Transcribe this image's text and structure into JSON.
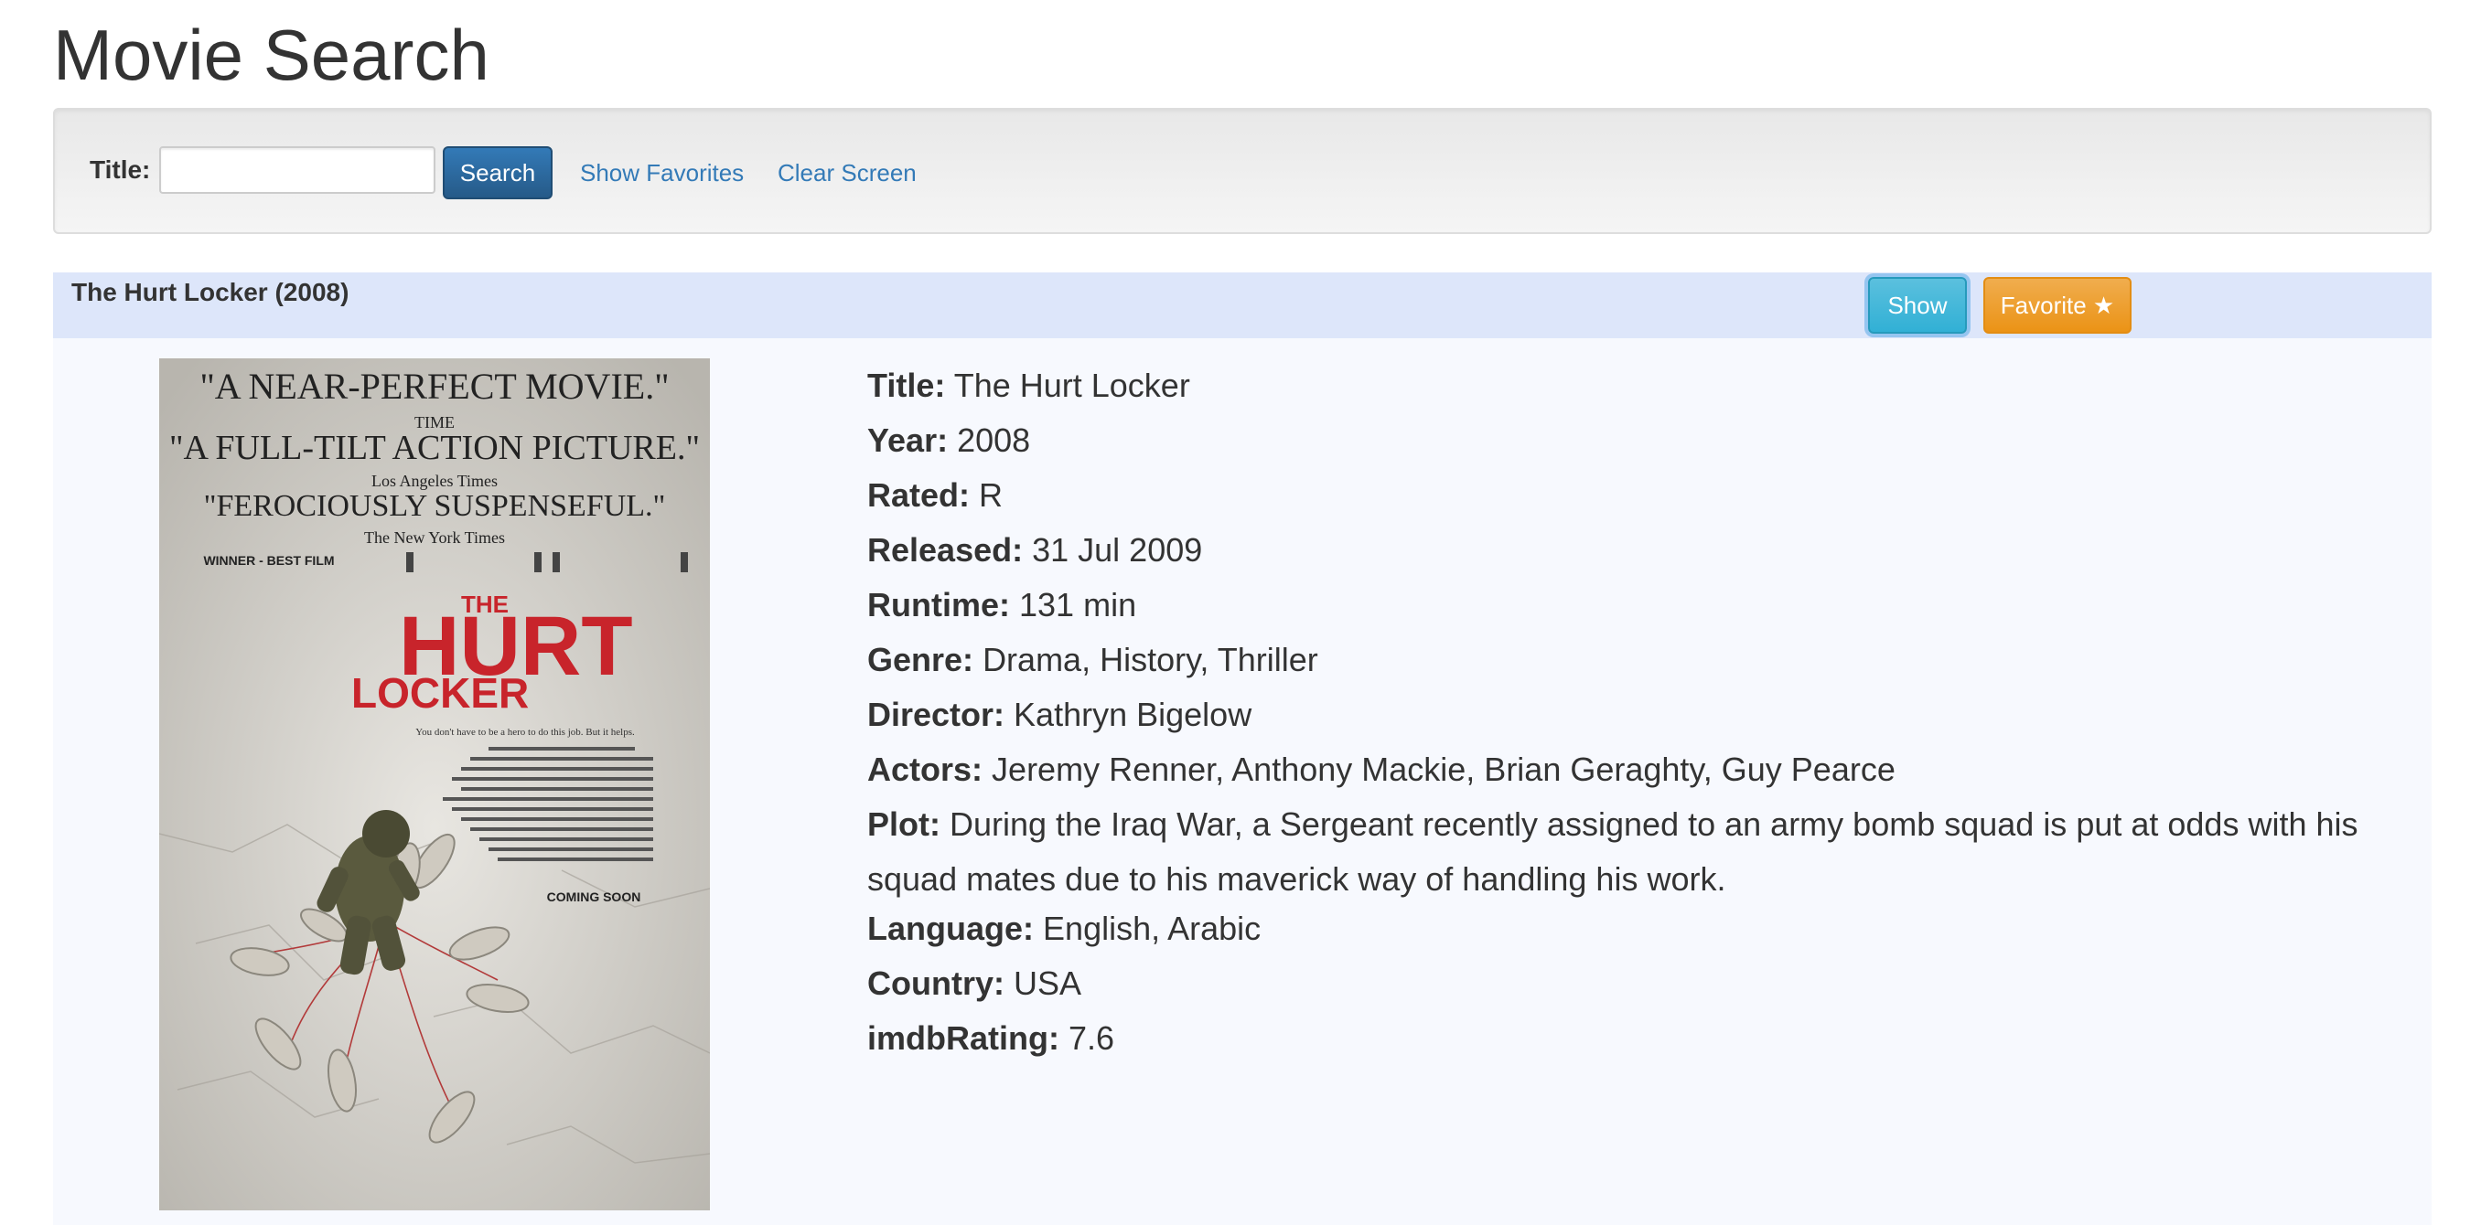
{
  "page": {
    "title": "Movie Search"
  },
  "search": {
    "label": "Title:",
    "value": "",
    "placeholder": "",
    "button_label": "Search",
    "show_favorites_label": "Show Favorites",
    "clear_screen_label": "Clear Screen"
  },
  "result": {
    "header_title": "The Hurt Locker (2008)",
    "show_button_label": "Show",
    "favorite_button_label": "Favorite ★",
    "poster": {
      "quotes": [
        {
          "quote": "\"A NEAR-PERFECT MOVIE.\"",
          "source": "TIME"
        },
        {
          "quote": "\"A FULL-TILT ACTION PICTURE.\"",
          "source": "Los Angeles Times"
        },
        {
          "quote": "\"FEROCIOUSLY SUSPENSEFUL.\"",
          "source": "The New York Times"
        }
      ],
      "award": "WINNER - BEST FILM",
      "title_line1": "THE",
      "title_line2": "HURT",
      "title_line3": "LOCKER",
      "tagline": "You don't have to be a hero to do this job. But it helps.",
      "coming_soon": "COMING SOON"
    },
    "details": [
      {
        "key": "Title:",
        "value": "The Hurt Locker"
      },
      {
        "key": "Year:",
        "value": "2008"
      },
      {
        "key": "Rated:",
        "value": "R"
      },
      {
        "key": "Released:",
        "value": "31 Jul 2009"
      },
      {
        "key": "Runtime:",
        "value": "131 min"
      },
      {
        "key": "Genre:",
        "value": "Drama, History, Thriller"
      },
      {
        "key": "Director:",
        "value": "Kathryn Bigelow"
      },
      {
        "key": "Actors:",
        "value": "Jeremy Renner, Anthony Mackie, Brian Geraghty, Guy Pearce"
      },
      {
        "key": "Plot:",
        "value": "During the Iraq War, a Sergeant recently assigned to an army bomb squad is put at odds with his squad mates due to his maverick way of handling his work."
      },
      {
        "key": "Language:",
        "value": "English, Arabic"
      },
      {
        "key": "Country:",
        "value": "USA"
      },
      {
        "key": "imdbRating:",
        "value": "7.6"
      }
    ]
  },
  "colors": {
    "primary": "#337ab7",
    "info": "#5bc0de",
    "warning": "#f0ad4e",
    "header_band": "#dde6fa",
    "body_band": "#f7f9fe",
    "poster_title_red": "#c8242b"
  }
}
